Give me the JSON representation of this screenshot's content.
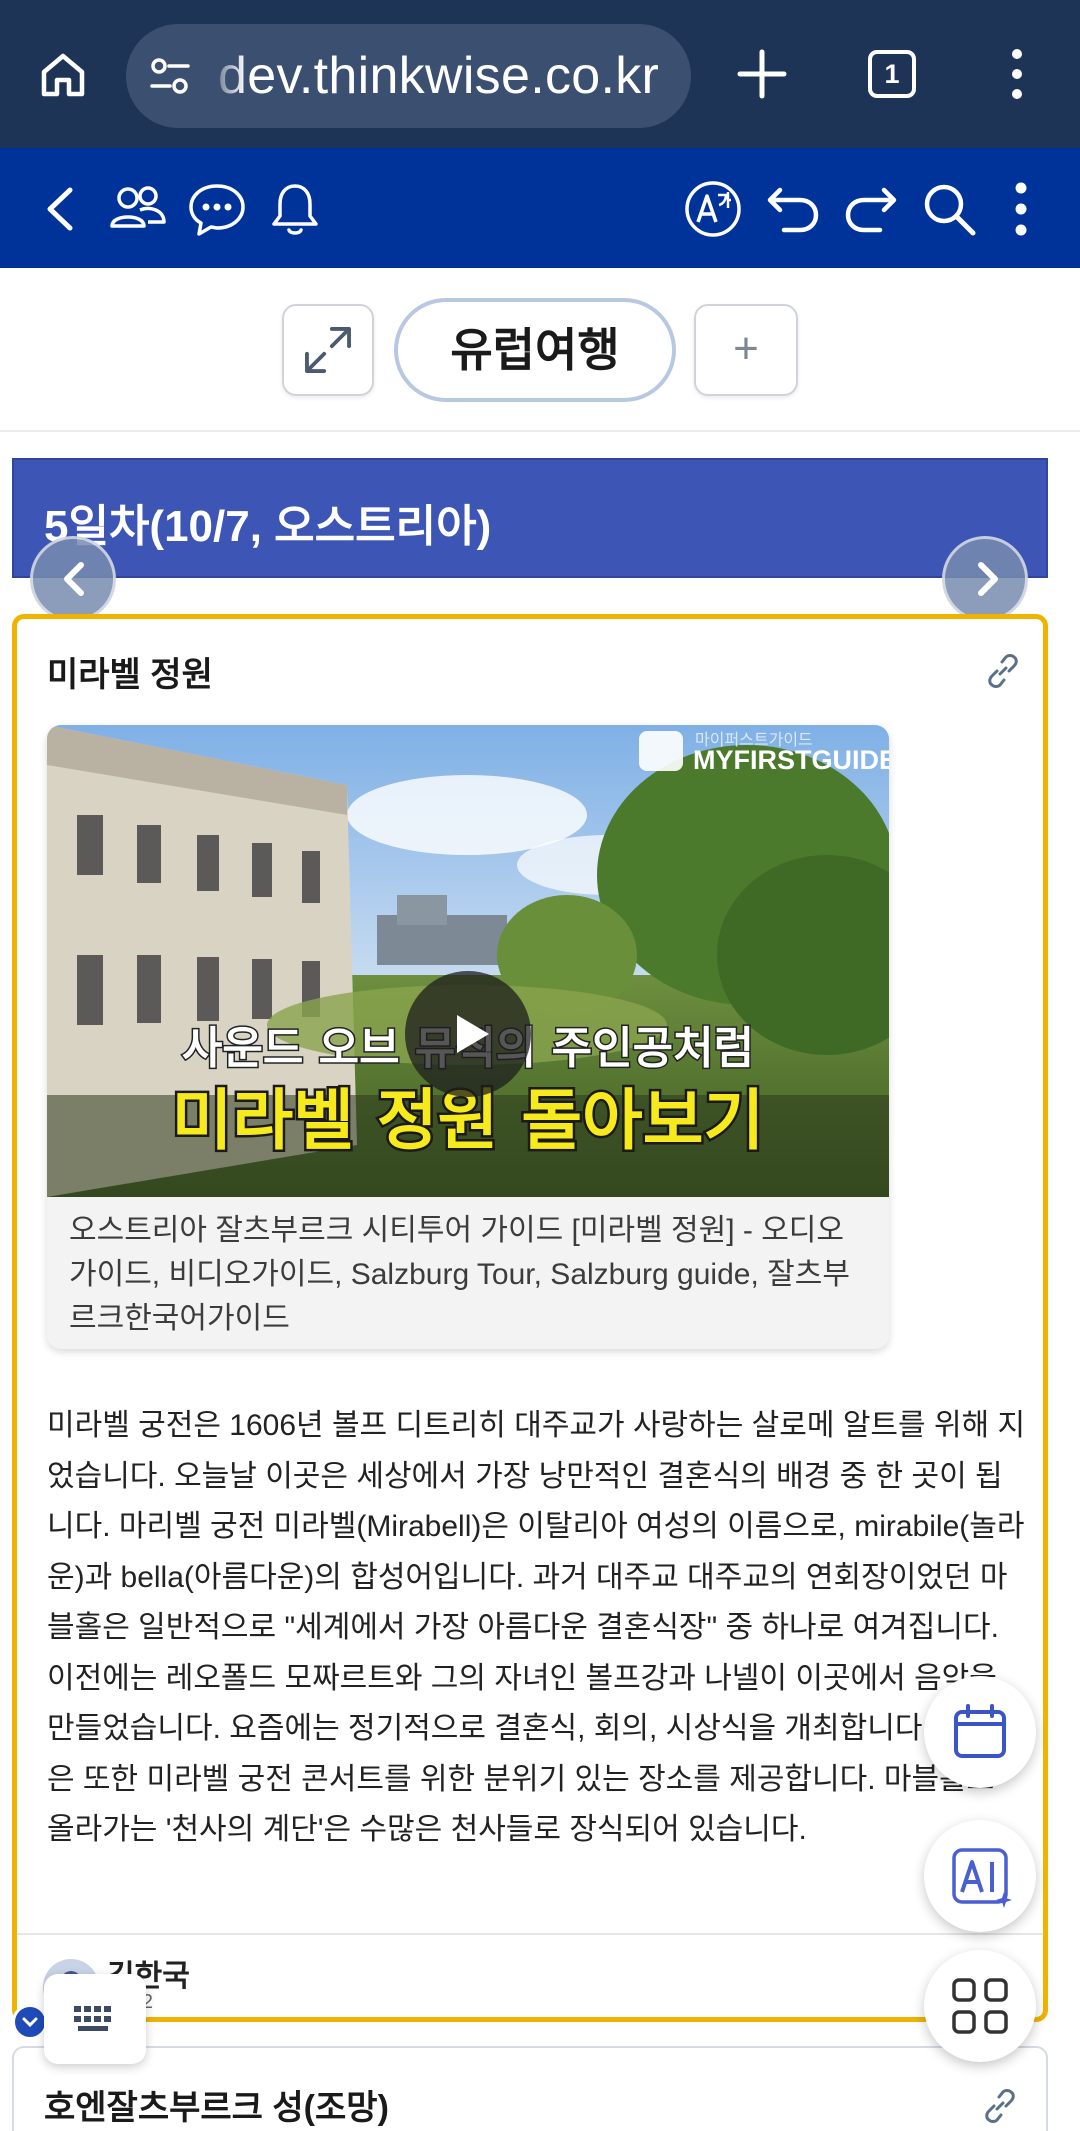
{
  "browser": {
    "url": "dev.thinkwise.co.kr",
    "tab_count": "1"
  },
  "tabs": {
    "active": "유럽여행",
    "add_label": "+"
  },
  "day": {
    "title": "5일차(10/7, 오스트리아)"
  },
  "card": {
    "title": "미라벨 정원",
    "video": {
      "thumbnail_brand": "MYFIRSTGUIDE",
      "thumbnail_brand_ko": "마이퍼스트가이드",
      "thumbnail_line1": "사운드 오브 뮤직의 주인공처럼",
      "thumbnail_line2": "미라벨 정원 돌아보기",
      "caption": "오스트리아 잘츠부르크 시티투어 가이드 [미라벨 정원] - 오디오가이드, 비디오가이드, Salzburg Tour, Salzburg guide, 잘츠부르크한국어가이드"
    },
    "body": "미라벨 궁전은 1606년 볼프 디트리히 대주교가 사랑하는 살로메 알트를 위해 지었습니다. 오늘날 이곳은 세상에서 가장 낭만적인 결혼식의 배경 중 한 곳이 됩니다. 마리벨 궁전 미라벨(Mirabell)은 이탈리아 여성의 이름으로, mirabile(놀라운)과 bella(아름다운)의 합성어입니다. 과거 대주교 대주교의 연회장이었던 마블홀은 일반적으로 \"세계에서 가장 아름다운 결혼식장\" 중 하나로 여겨집니다. 이전에는 레오폴드 모짜르트와 그의 자녀인 볼프강과 나넬이 이곳에서 음악을 만들었습니다. 요즘에는 정기적으로 결혼식, 회의, 시상식을 개최합니다. 마블홀은 또한 미라벨 궁전 콘서트를 위한 분위기 있는 장소를 제공합니다. 마블홀로 올라가는 '천사의 계단'은 수많은 천사들로 장식되어 있습니다.",
    "author": "김한국",
    "date": "5-12"
  },
  "next_card": {
    "title": "호엔잘츠부르크 성(조망)"
  },
  "icons": [
    "home-icon",
    "site-settings-icon",
    "new-tab-icon",
    "tab-switcher-icon",
    "menu-icon",
    "back-icon",
    "members-icon",
    "chat-icon",
    "bell-icon",
    "translate-icon",
    "undo-icon",
    "redo-icon",
    "search-icon",
    "more-icon",
    "expand-icon",
    "link-icon",
    "play-icon",
    "calendar-icon",
    "ai-icon",
    "apps-icon",
    "keyboard-icon"
  ],
  "colors": {
    "browser_bar": "#1e3457",
    "app_bar": "#003399",
    "day_header": "#3d55b4",
    "card_border": "#f0b400"
  }
}
